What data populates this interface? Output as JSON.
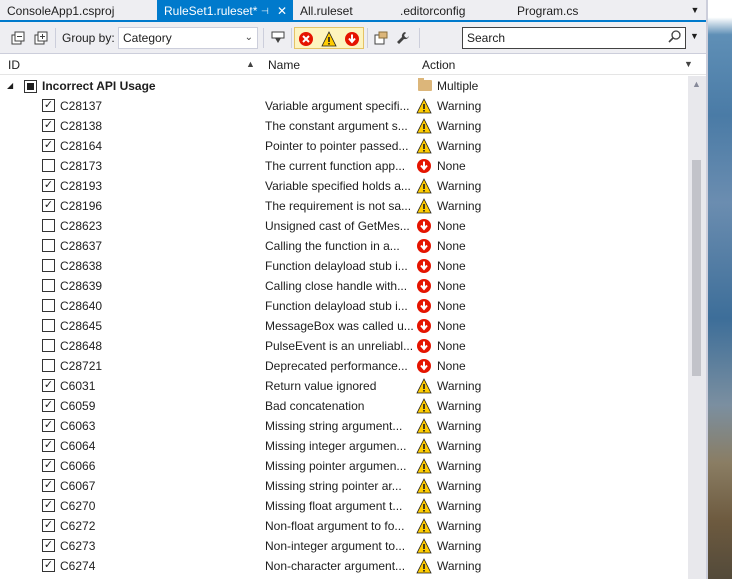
{
  "tabs": [
    {
      "label": "ConsoleApp1.csproj",
      "active": false
    },
    {
      "label": "RuleSet1.ruleset*",
      "active": true
    },
    {
      "label": "All.ruleset",
      "active": false
    },
    {
      "label": ".editorconfig",
      "active": false
    },
    {
      "label": "Program.cs",
      "active": false
    }
  ],
  "tab_pin_glyph": "⊣",
  "tab_close_glyph": "✕",
  "toolbar": {
    "group_by_label": "Group by:",
    "group_by_value": "Category",
    "search_placeholder": "Search"
  },
  "columns": {
    "id": "ID",
    "name": "Name",
    "action": "Action"
  },
  "group": {
    "label": "Incorrect API Usage",
    "action": "Multiple"
  },
  "rules": [
    {
      "id": "C28137",
      "checked": true,
      "name": "Variable argument specifi...",
      "action": "Warning"
    },
    {
      "id": "C28138",
      "checked": true,
      "name": "The constant argument s...",
      "action": "Warning"
    },
    {
      "id": "C28164",
      "checked": true,
      "name": "Pointer to pointer passed...",
      "action": "Warning"
    },
    {
      "id": "C28173",
      "checked": false,
      "name": "The current function app...",
      "action": "None"
    },
    {
      "id": "C28193",
      "checked": true,
      "name": "Variable specified holds a...",
      "action": "Warning"
    },
    {
      "id": "C28196",
      "checked": true,
      "name": "The requirement is not sa...",
      "action": "Warning"
    },
    {
      "id": "C28623",
      "checked": false,
      "name": "Unsigned cast of GetMes...",
      "action": "None"
    },
    {
      "id": "C28637",
      "checked": false,
      "name": "Calling the function in a...",
      "action": "None"
    },
    {
      "id": "C28638",
      "checked": false,
      "name": "Function delayload stub i...",
      "action": "None"
    },
    {
      "id": "C28639",
      "checked": false,
      "name": "Calling close handle with...",
      "action": "None"
    },
    {
      "id": "C28640",
      "checked": false,
      "name": "Function delayload stub i...",
      "action": "None"
    },
    {
      "id": "C28645",
      "checked": false,
      "name": "MessageBox was called u...",
      "action": "None"
    },
    {
      "id": "C28648",
      "checked": false,
      "name": "PulseEvent is an unreliabl...",
      "action": "None"
    },
    {
      "id": "C28721",
      "checked": false,
      "name": "Deprecated performance...",
      "action": "None"
    },
    {
      "id": "C6031",
      "checked": true,
      "name": "Return value ignored",
      "action": "Warning"
    },
    {
      "id": "C6059",
      "checked": true,
      "name": "Bad concatenation",
      "action": "Warning"
    },
    {
      "id": "C6063",
      "checked": true,
      "name": "Missing string argument...",
      "action": "Warning"
    },
    {
      "id": "C6064",
      "checked": true,
      "name": "Missing integer argumen...",
      "action": "Warning"
    },
    {
      "id": "C6066",
      "checked": true,
      "name": "Missing pointer argumen...",
      "action": "Warning"
    },
    {
      "id": "C6067",
      "checked": true,
      "name": "Missing string pointer ar...",
      "action": "Warning"
    },
    {
      "id": "C6270",
      "checked": true,
      "name": "Missing float argument t...",
      "action": "Warning"
    },
    {
      "id": "C6272",
      "checked": true,
      "name": "Non-float argument to fo...",
      "action": "Warning"
    },
    {
      "id": "C6273",
      "checked": true,
      "name": "Non-integer argument to...",
      "action": "Warning"
    },
    {
      "id": "C6274",
      "checked": true,
      "name": "Non-character argument...",
      "action": "Warning"
    }
  ],
  "colors": {
    "accent": "#007acc",
    "error_red": "#e51400",
    "warning_yellow": "#ffcc00"
  }
}
